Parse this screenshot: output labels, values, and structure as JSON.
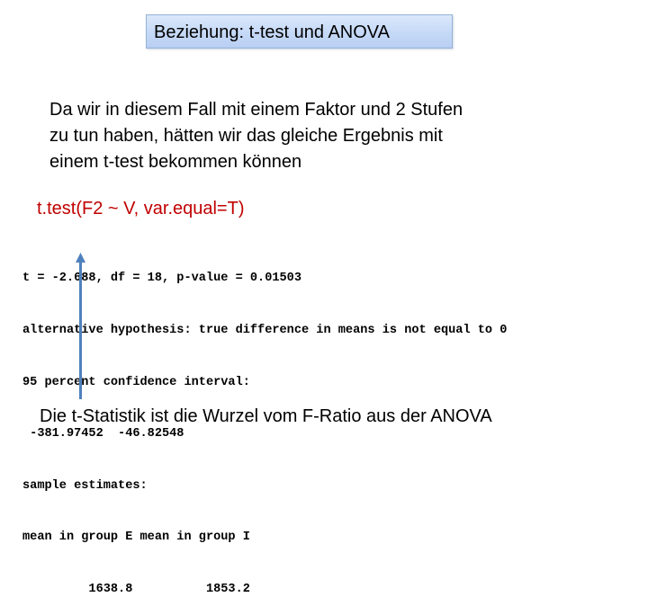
{
  "slide": {
    "title": "Beziehung: t-test und ANOVA",
    "intro_lines": [
      "Da wir in diesem Fall mit einem Faktor und 2 Stufen",
      "zu tun haben, hätten wir das gleiche Ergebnis mit",
      "einem t-test bekommen können"
    ],
    "command": "t.test(F2 ~ V, var.equal=T)",
    "output_lines": [
      "t = -2.688, df = 18, p-value = 0.01503",
      "alternative hypothesis: true difference in means is not equal to 0",
      "95 percent confidence interval:",
      " -381.97452  -46.82548",
      "sample estimates:",
      "mean in group E mean in group I",
      "         1638.8          1853.2"
    ],
    "conclusion": "Die t-Statistik ist die Wurzel vom F-Ratio aus der ANOVA",
    "colors": {
      "command": "#c00000",
      "arrow": "#4f81bd",
      "title_box_border": "#95b3d7",
      "title_box_fill": "#c5d9f7"
    }
  }
}
